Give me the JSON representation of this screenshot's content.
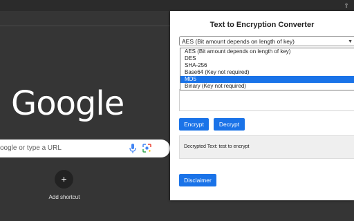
{
  "browser": {
    "google_logo": "Google",
    "search_placeholder": "oogle or type a URL",
    "add_shortcut_label": "Add shortcut",
    "add_shortcut_symbol": "+"
  },
  "popup": {
    "title": "Text to Encryption Converter",
    "select": {
      "current_value": "AES (Bit amount depends on length of key)",
      "options": [
        "AES (Bit amount depends on length of key)",
        "DES",
        "SHA-256",
        "Base64 (Key not required)",
        "MD5",
        "Binary (Key not required)"
      ],
      "highlighted_option": "MD5"
    },
    "buttons": {
      "encrypt": "Encrypt",
      "decrypt": "Decrypt",
      "disclaimer": "Disclaimer"
    },
    "output": {
      "label": "Decrypted Text:",
      "value": "test to encrypt"
    }
  },
  "colors": {
    "accent": "#1a73e8",
    "page_background": "#353535"
  }
}
